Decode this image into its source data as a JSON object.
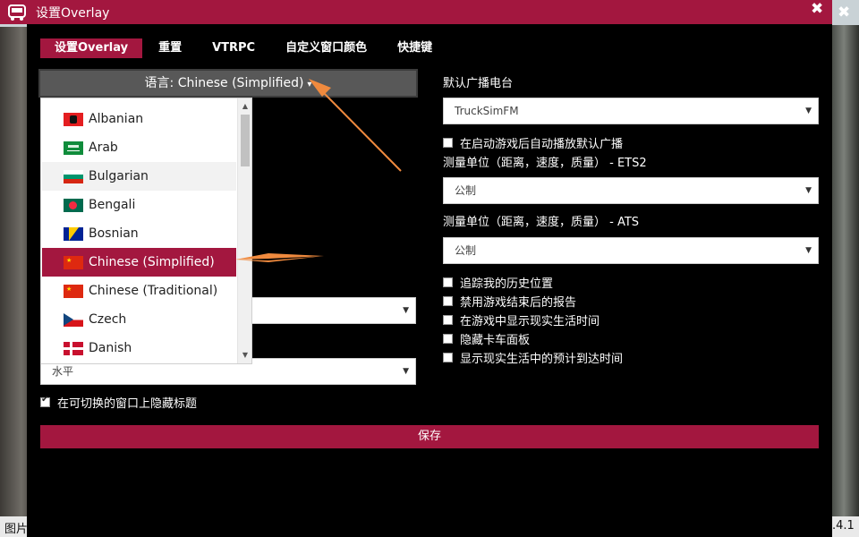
{
  "window": {
    "title": "设置Overlay",
    "close_symbol": "✖",
    "outer_close_symbol": "✖"
  },
  "tabs": [
    {
      "label": "设置Overlay",
      "active": true
    },
    {
      "label": "重置",
      "active": false
    },
    {
      "label": "VTRPC",
      "active": false
    },
    {
      "label": "自定义窗口颜色",
      "active": false
    },
    {
      "label": "快捷键",
      "active": false
    }
  ],
  "language": {
    "button_label": "语言: Chinese (Simplified)",
    "caret": "▾",
    "options": [
      {
        "label": "Albanian",
        "flag": "albania-flag-icon"
      },
      {
        "label": "Arab",
        "flag": "saudi-flag-icon"
      },
      {
        "label": "Bulgarian",
        "flag": "bulgaria-flag-icon"
      },
      {
        "label": "Bengali",
        "flag": "bangladesh-flag-icon"
      },
      {
        "label": "Bosnian",
        "flag": "bosnia-flag-icon"
      },
      {
        "label": "Chinese (Simplified)",
        "flag": "china-flag-icon",
        "selected": true
      },
      {
        "label": "Chinese (Traditional)",
        "flag": "china-flag-icon"
      },
      {
        "label": "Czech",
        "flag": "czech-flag-icon"
      },
      {
        "label": "Danish",
        "flag": "denmark-flag-icon"
      }
    ]
  },
  "left_panel": {
    "hidden_select_value": "",
    "orientation_value": "水平",
    "hide_title_checkbox": {
      "label": "在可切换的窗口上隐藏标题",
      "checked": true
    }
  },
  "right_panel": {
    "radio_label": "默认广播电台",
    "radio_value": "TruckSimFM",
    "autoplay_checkbox": {
      "label": "在启动游戏后自动播放默认广播",
      "checked": false
    },
    "units_ets2_label": "测量单位（距离，速度，质量） - ETS2",
    "units_ets2_value": "公制",
    "units_ats_label": "测量单位（距离，速度，质量） - ATS",
    "units_ats_value": "公制",
    "checkboxes": [
      {
        "label": "追踪我的历史位置",
        "checked": false
      },
      {
        "label": "禁用游戏结束后的报告",
        "checked": false
      },
      {
        "label": "在游戏中显示现实生活时间",
        "checked": false
      },
      {
        "label": "隐藏卡车面板",
        "checked": false
      },
      {
        "label": "显示现实生活中的预计到达时间",
        "checked": false
      }
    ]
  },
  "save_label": "保存",
  "footer": {
    "left_text": "图片",
    "right_text": ".4.1"
  },
  "colors": {
    "accent": "#a3173f",
    "window_bg": "#000000",
    "arrow": "#f08a3e"
  }
}
